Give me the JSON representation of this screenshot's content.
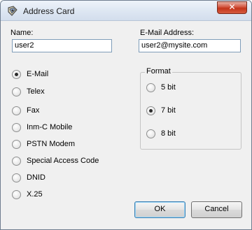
{
  "window": {
    "title": "Address Card",
    "close_label": "✕"
  },
  "fields": {
    "name_label": "Name:",
    "name_value": "user2",
    "email_label": "E-Mail Address:",
    "email_value": "user2@mysite.com"
  },
  "types": [
    {
      "label": "E-Mail",
      "checked": true
    },
    {
      "label": "Telex",
      "checked": false
    },
    {
      "label": "Fax",
      "checked": false
    },
    {
      "label": "Inm-C Mobile",
      "checked": false
    },
    {
      "label": "PSTN Modem",
      "checked": false
    },
    {
      "label": "Special Access Code",
      "checked": false
    },
    {
      "label": "DNID",
      "checked": false
    },
    {
      "label": "X.25",
      "checked": false
    }
  ],
  "format": {
    "title": "Format",
    "options": [
      {
        "label": "5 bit",
        "checked": false
      },
      {
        "label": "7 bit",
        "checked": true
      },
      {
        "label": "8 bit",
        "checked": false
      }
    ]
  },
  "buttons": {
    "ok": "OK",
    "cancel": "Cancel"
  }
}
